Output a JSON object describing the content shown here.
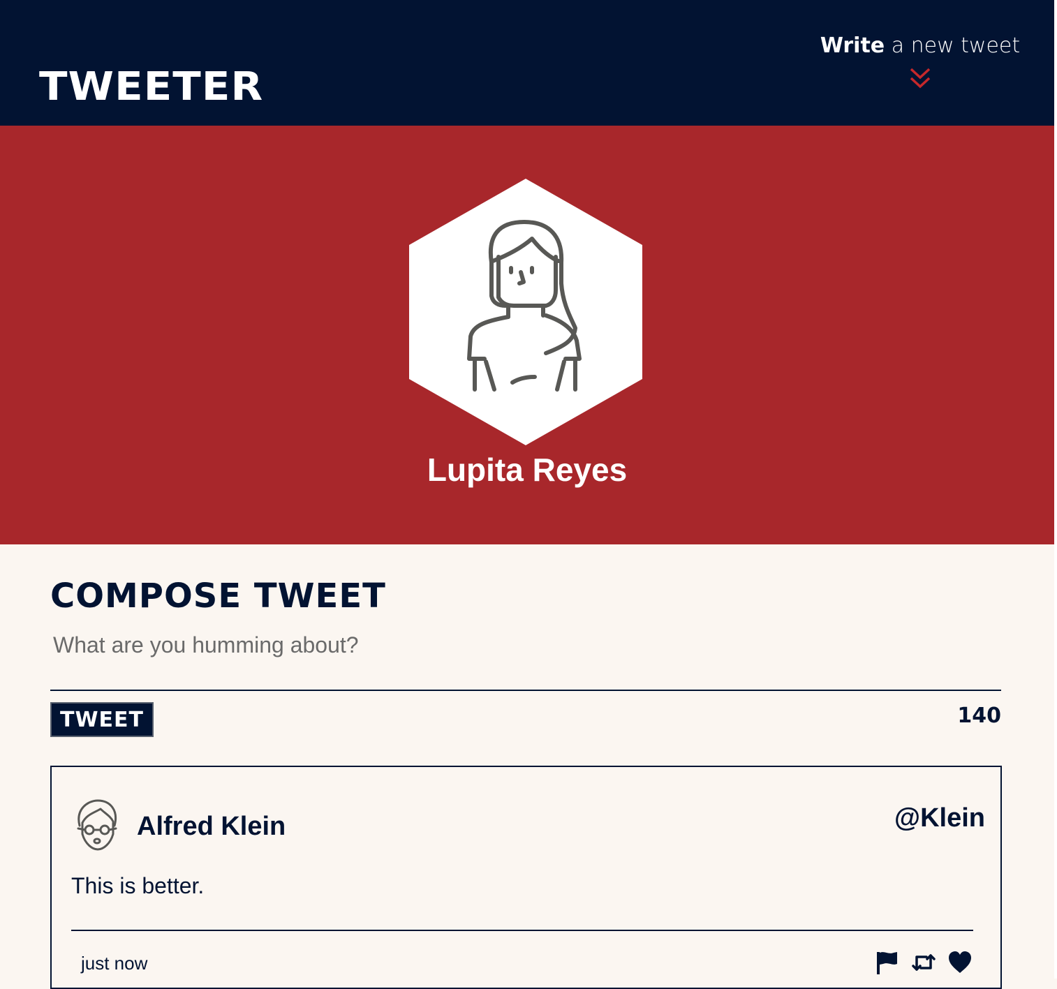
{
  "nav": {
    "brand": "TWEETER",
    "write_strong": "Write",
    "write_rest": " a new tweet",
    "chevron_icon": "double-chevron-down-icon",
    "chevron_color": "#c6282b"
  },
  "profile": {
    "name": "Lupita Reyes",
    "avatar_icon": "woman-avatar-icon",
    "background_color": "#a8272b"
  },
  "compose": {
    "title": "COMPOSE TWEET",
    "placeholder": "What are you humming about?",
    "button_label": "TWEET",
    "counter": "140"
  },
  "tweets": [
    {
      "name": "Alfred Klein",
      "handle": "@Klein",
      "text": "This is better.",
      "time": "just now",
      "avatar_icon": "man-with-glasses-avatar-icon",
      "actions": [
        "flag-icon",
        "retweet-icon",
        "heart-icon"
      ]
    }
  ],
  "colors": {
    "navy": "#021332",
    "red": "#a8272b",
    "page_bg": "#fbf6f1"
  }
}
